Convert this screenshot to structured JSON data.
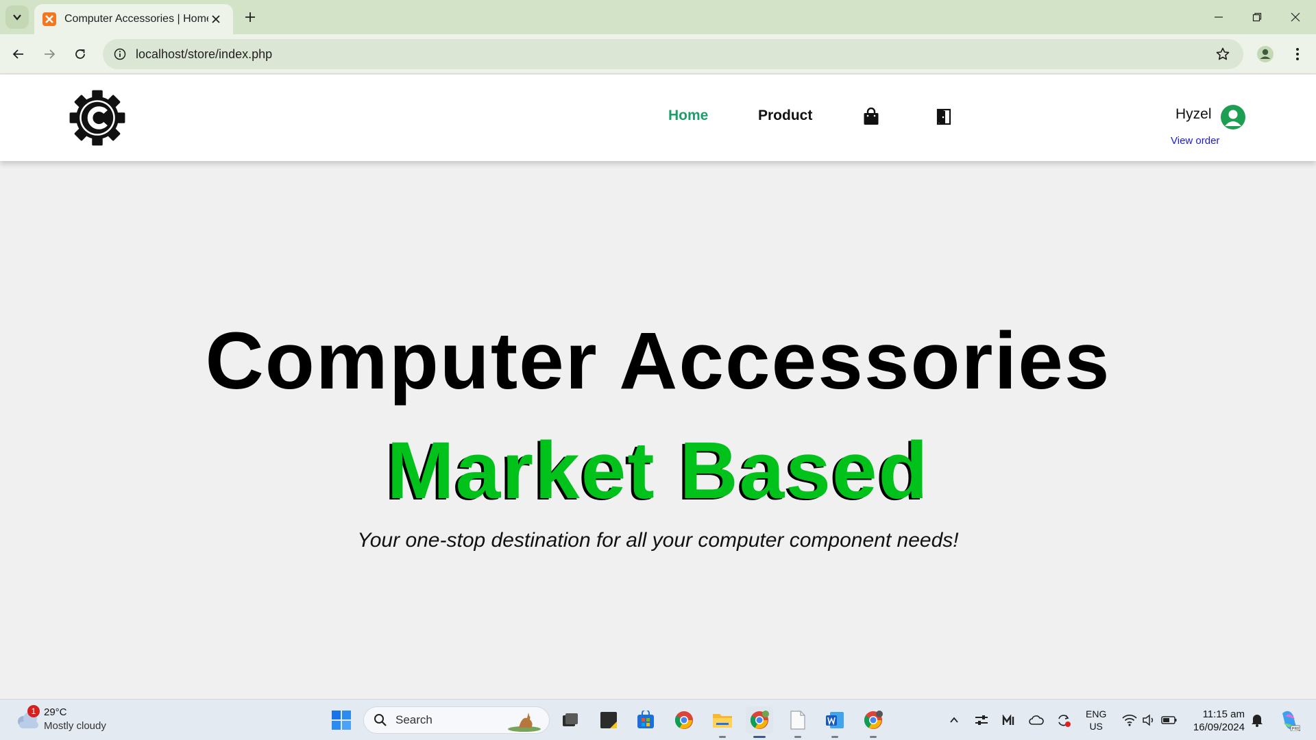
{
  "browser": {
    "tab_title": "Computer Accessories | Home",
    "url": "localhost/store/index.php"
  },
  "site": {
    "nav": {
      "home_label": "Home",
      "product_label": "Product",
      "active": "Home"
    },
    "user": {
      "name": "Hyzel",
      "view_order_label": "View order"
    },
    "hero": {
      "title": "Computer Accessories",
      "subtitle": "Market Based",
      "tagline": "Your one-stop destination for all your computer component needs!"
    },
    "colors": {
      "accent_green": "#00c21a",
      "nav_active": "#1e9e6a",
      "link_blue": "#1a1ad6"
    }
  },
  "taskbar": {
    "weather": {
      "temperature": "29°C",
      "condition": "Mostly cloudy",
      "badge_count": "1"
    },
    "search_placeholder": "Search",
    "language": {
      "line1": "ENG",
      "line2": "US"
    },
    "clock": {
      "time": "11:15 am",
      "date": "16/09/2024"
    },
    "apps": [
      "windows-start-icon",
      "task-view-icon",
      "sticky-notes-icon",
      "microsoft-store-icon",
      "chrome-icon",
      "file-explorer-icon",
      "chrome-profile-icon",
      "notepad-icon",
      "word-icon",
      "chrome-alt-icon"
    ]
  }
}
